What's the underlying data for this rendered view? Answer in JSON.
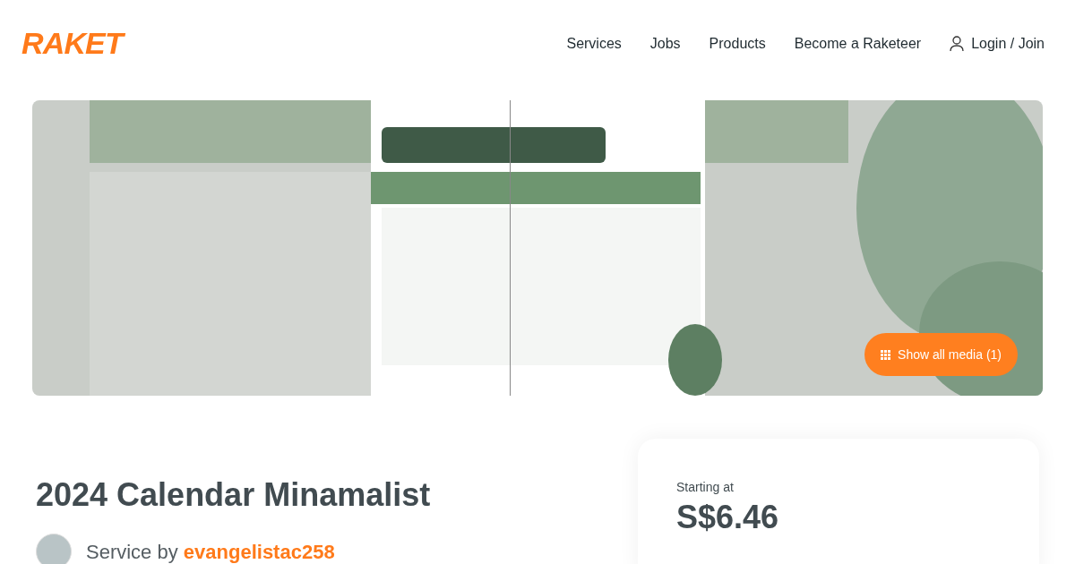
{
  "header": {
    "logo": "RAKET",
    "nav": [
      "Services",
      "Jobs",
      "Products",
      "Become a Raketeer"
    ],
    "login": "Login / Join"
  },
  "media": {
    "kind": "picture",
    "button": "Show all media (1)"
  },
  "service": {
    "title": "2024 Calendar Minamalist",
    "by_label": "Service by",
    "seller": "evangelistac258"
  },
  "price_card": {
    "label": "Starting at",
    "price": "S$6.46"
  }
}
